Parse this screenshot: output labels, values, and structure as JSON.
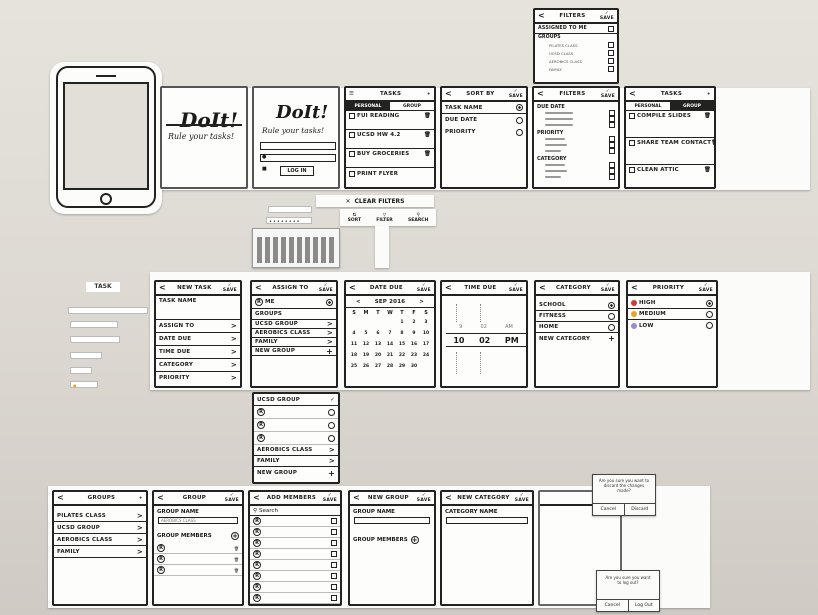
{
  "splash": {
    "title": "DoIt!",
    "tagline": "Rule your tasks!"
  },
  "login": {
    "title": "DoIt!",
    "tagline": "Rule your tasks!",
    "button": "LOG IN"
  },
  "tasks": {
    "title": "TASKS",
    "tabs": [
      "PERSONAL",
      "GROUP"
    ],
    "items": [
      "FUI READING",
      "UCSD HW 4.2",
      "BUY GROCERIES",
      "PRINT FLYER"
    ],
    "toolbar": {
      "clear_filters": "CLEAR FILTERS",
      "sort": "SORT",
      "filter": "FILTER",
      "search": "SEARCH"
    }
  },
  "sort_by": {
    "title": "SORT BY",
    "action": "SAVE",
    "options": [
      "TASK NAME",
      "DUE DATE",
      "PRIORITY"
    ]
  },
  "filters_wide": {
    "title": "FILTERS",
    "action": "SAVE",
    "sections": [
      {
        "label": "DUE DATE",
        "items": [
          "",
          "",
          ""
        ]
      },
      {
        "label": "PRIORITY",
        "items": [
          "",
          "",
          ""
        ]
      },
      {
        "label": "CATEGORY",
        "items": [
          "",
          "",
          ""
        ]
      }
    ]
  },
  "filters_top": {
    "title": "FILTERS",
    "action": "SAVE",
    "assigned": "ASSIGNED TO ME",
    "groups_label": "GROUPS",
    "groups": [
      "PILATES CLASS",
      "UCSD CLASS",
      "AEROBICS CLASS",
      "FAMILY"
    ]
  },
  "tasks_grouped": {
    "title": "TASKS",
    "tabs": [
      "PERSONAL",
      "GROUP"
    ],
    "items": [
      "COMPILE SLIDES",
      "SHARE TEAM CONTACT",
      "CLEAN ATTIC"
    ]
  },
  "new_task": {
    "title": "NEW TASK",
    "action": "SAVE",
    "fields": [
      "TASK NAME",
      "ASSIGN TO",
      "DATE DUE",
      "TIME DUE",
      "CATEGORY",
      "PRIORITY"
    ]
  },
  "assign_to": {
    "title": "ASSIGN TO",
    "action": "SAVE",
    "me": "ME",
    "groups_label": "GROUPS",
    "groups": [
      "UCSD GROUP",
      "AEROBICS CLASS",
      "FAMILY"
    ],
    "new_group": "NEW GROUP"
  },
  "date_due": {
    "title": "DATE DUE",
    "action": "SAVE",
    "month": "SEP 2016",
    "weekdays": [
      "S",
      "M",
      "T",
      "W",
      "T",
      "F",
      "S"
    ],
    "days": [
      "",
      "",
      "",
      "",
      "1",
      "2",
      "3",
      "4",
      "5",
      "6",
      "7",
      "8",
      "9",
      "10",
      "11",
      "12",
      "13",
      "14",
      "15",
      "16",
      "17",
      "18",
      "19",
      "20",
      "21",
      "22",
      "23",
      "24",
      "25",
      "26",
      "27",
      "28",
      "29",
      "30",
      ""
    ]
  },
  "time_due": {
    "title": "TIME DUE",
    "action": "SAVE",
    "picker_top": [
      "9",
      "02",
      "AM"
    ],
    "picker_mid": [
      "10",
      "02",
      "PM"
    ]
  },
  "category": {
    "title": "CATEGORY",
    "action": "SAVE",
    "options": [
      "SCHOOL",
      "FITNESS",
      "HOME"
    ],
    "new_category": "NEW CATEGORY"
  },
  "priority": {
    "title": "PRIORITY",
    "action": "SAVE",
    "options": [
      "HIGH",
      "MEDIUM",
      "LOW"
    ],
    "colors": [
      "#d23a3a",
      "#e6a42a",
      "#9b8cc9"
    ]
  },
  "groups_expanded": {
    "ucsd": "UCSD GROUP",
    "members": [
      "",
      "",
      ""
    ],
    "rest": [
      "AEROBICS CLASS",
      "FAMILY",
      "NEW GROUP"
    ]
  },
  "groups_list": {
    "title": "GROUPS",
    "items": [
      "PILATES CLASS",
      "UCSD GROUP",
      "AEROBICS CLASS",
      "FAMILY"
    ]
  },
  "group_edit": {
    "title": "GROUP",
    "action": "SAVE",
    "name_label": "GROUP NAME",
    "name_value": "AEROBICS CLASS",
    "members_label": "GROUP MEMBERS",
    "members": [
      "",
      "",
      ""
    ]
  },
  "add_members": {
    "title": "ADD MEMBERS",
    "action": "SAVE",
    "search": "Search",
    "people": [
      "",
      "",
      "",
      "",
      "",
      "",
      "",
      ""
    ]
  },
  "new_group": {
    "title": "NEW GROUP",
    "action": "SAVE",
    "name_label": "GROUP NAME",
    "members_label": "GROUP MEMBERS"
  },
  "new_category": {
    "title": "NEW CATEGORY",
    "action": "SAVE",
    "name_label": "CATEGORY NAME"
  },
  "dialog_discard": {
    "text": "Are you sure you want to discard the changes made?",
    "cancel": "Cancel",
    "confirm": "Discard"
  },
  "dialog_logout": {
    "text": "Are you sure you want to log out?",
    "cancel": "Cancel",
    "confirm": "Log Out"
  },
  "loose_tags": {
    "task": "TASK"
  }
}
